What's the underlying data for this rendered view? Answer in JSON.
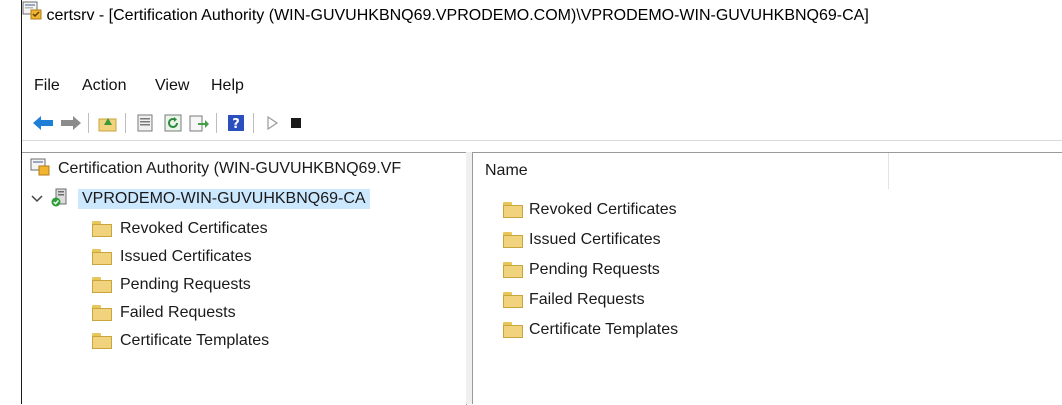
{
  "window": {
    "title": "certsrv - [Certification Authority (WIN-GUVUHKBNQ69.VPRODEMO.COM)\\VPRODEMO-WIN-GUVUHKBNQ69-CA]"
  },
  "menu": {
    "items": [
      "File",
      "Action",
      "View",
      "Help"
    ]
  },
  "toolbar": {
    "buttons": [
      "back-arrow-icon",
      "forward-arrow-icon",
      "up-folder-icon",
      "properties-icon",
      "refresh-icon",
      "export-list-icon",
      "help-icon",
      "start-service-icon",
      "stop-service-icon"
    ]
  },
  "tree": {
    "root_label": "Certification Authority (WIN-GUVUHKBNQ69.VF",
    "ca_label": "VPRODEMO-WIN-GUVUHKBNQ69-CA",
    "children": [
      "Revoked Certificates",
      "Issued Certificates",
      "Pending Requests",
      "Failed Requests",
      "Certificate Templates"
    ]
  },
  "list": {
    "column_name": "Name",
    "items": [
      "Revoked Certificates",
      "Issued Certificates",
      "Pending Requests",
      "Failed Requests",
      "Certificate Templates"
    ]
  },
  "colors": {
    "selection": "#cce8ff",
    "folder": "#f2d37d",
    "back_arrow": "#1e7fd6"
  }
}
